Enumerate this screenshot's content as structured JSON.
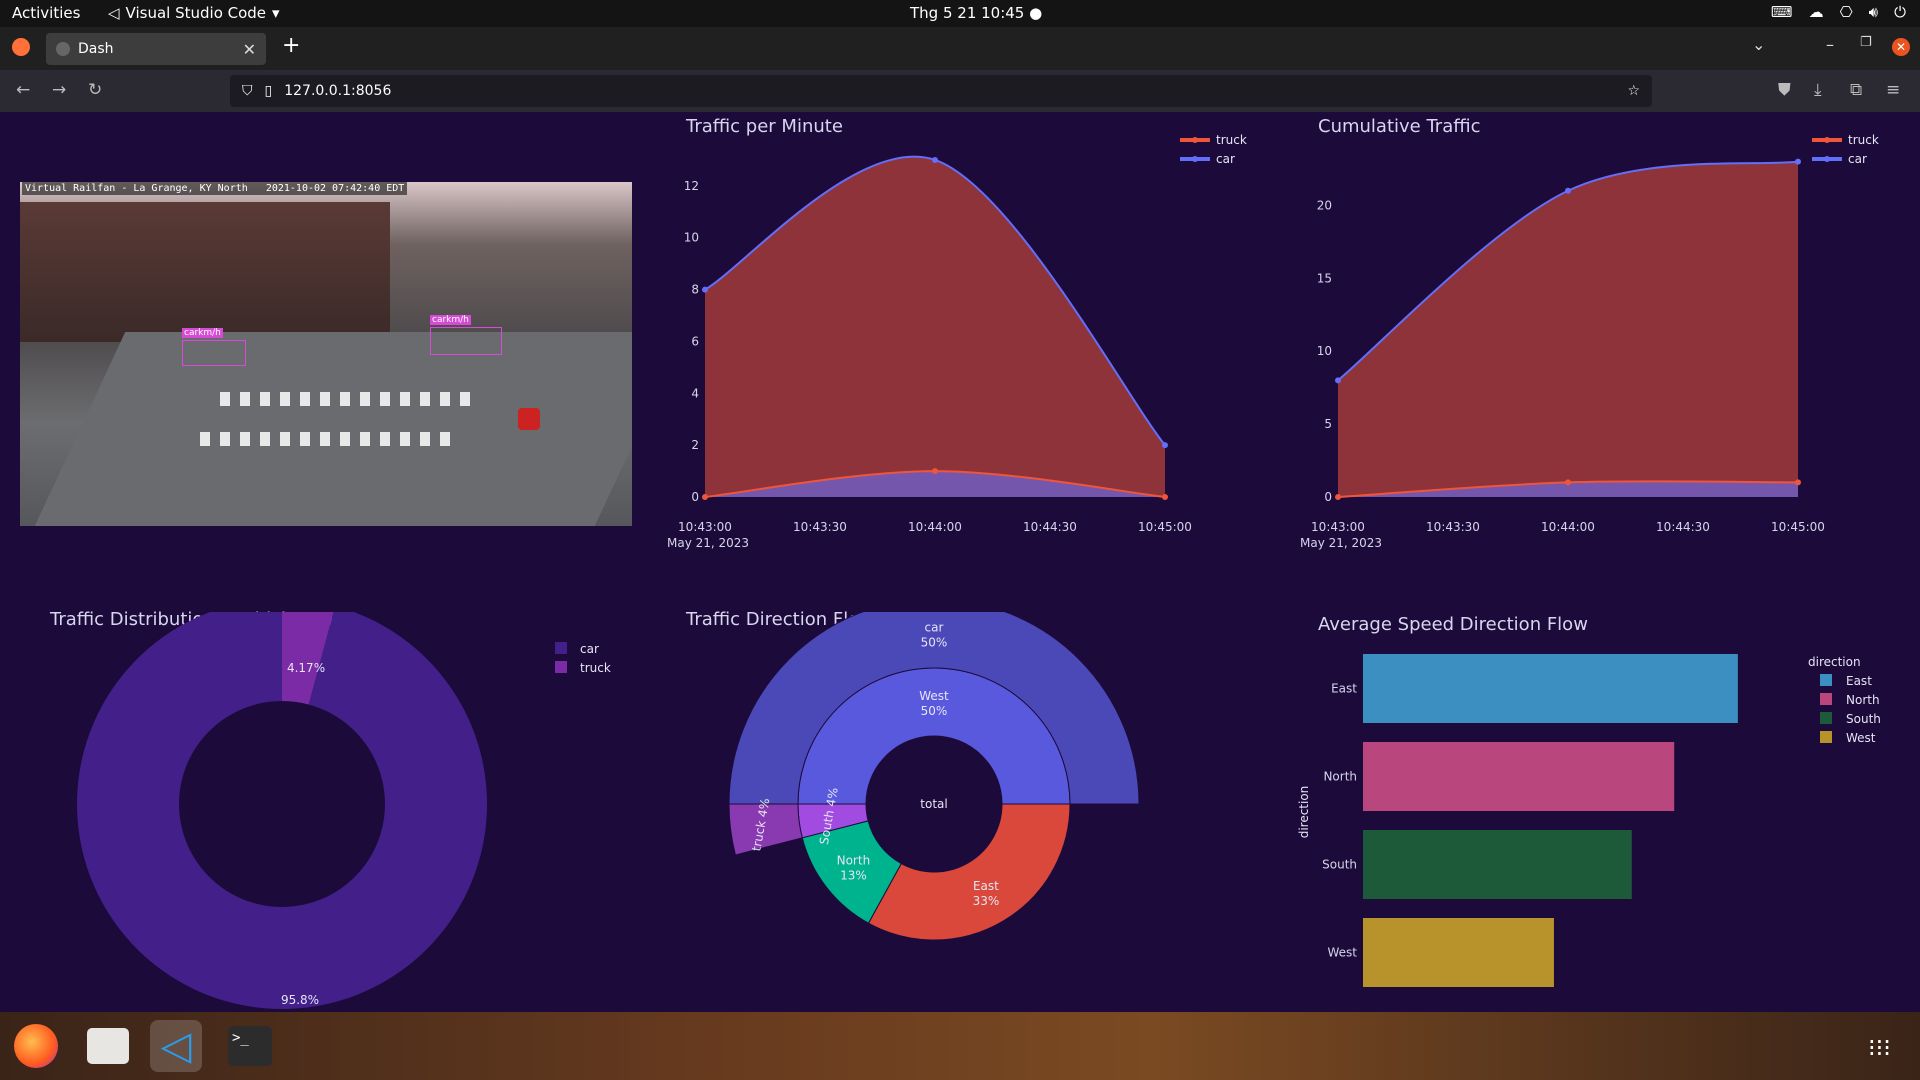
{
  "system": {
    "activities": "Activities",
    "app_name": "Visual Studio Code",
    "clock": "Thg 5 21  10:45"
  },
  "browser": {
    "tab_title": "Dash",
    "url": "127.0.0.1:8056"
  },
  "video": {
    "overlay": "Virtual Railfan - La Grange, KY North   2021-10-02 07:42:40 EDT",
    "det1": "carkm/h",
    "det2": "carkm/h"
  },
  "charts": {
    "traffic_title": "Traffic per Minute",
    "cumulative_title": "Cumulative Traffic",
    "distribution_title": "Traffic Distribution - Vehicle Type",
    "direction_title": "Traffic Direction Flow",
    "speed_title": "Average Speed Direction Flow"
  },
  "chart_data": [
    {
      "type": "area",
      "title": "Traffic per Minute",
      "x": [
        "10:43:00",
        "10:44:00",
        "10:45:00"
      ],
      "x_ticks": [
        "10:43:00",
        "10:43:30",
        "10:44:00",
        "10:44:30",
        "10:45:00"
      ],
      "x_date": "May 21, 2023",
      "series": [
        {
          "name": "truck",
          "values": [
            0,
            1,
            0
          ],
          "color": "#ef553b"
        },
        {
          "name": "car",
          "values": [
            8,
            13,
            2
          ],
          "color": "#636efa"
        }
      ],
      "y_ticks": [
        0,
        2,
        4,
        6,
        8,
        10,
        12
      ],
      "ylim": [
        0,
        13.5
      ],
      "legend": "top-right"
    },
    {
      "type": "area",
      "title": "Cumulative Traffic",
      "x": [
        "10:43:00",
        "10:44:00",
        "10:45:00"
      ],
      "x_ticks": [
        "10:43:00",
        "10:43:30",
        "10:44:00",
        "10:44:30",
        "10:45:00"
      ],
      "x_date": "May 21, 2023",
      "series": [
        {
          "name": "truck",
          "values": [
            0,
            1,
            1
          ],
          "color": "#ef553b"
        },
        {
          "name": "car",
          "values": [
            8,
            21,
            23
          ],
          "color": "#636efa"
        }
      ],
      "y_ticks": [
        0,
        5,
        10,
        15,
        20
      ],
      "ylim": [
        0,
        24
      ],
      "legend": "top-right"
    },
    {
      "type": "pie",
      "title": "Traffic Distribution - Vehicle Type",
      "labels": [
        "car",
        "truck"
      ],
      "values": [
        95.8,
        4.17
      ],
      "value_labels": [
        "95.8%",
        "4.17%"
      ],
      "colors": [
        "#431f8a",
        "#7b2ba6"
      ],
      "legend": "top-right"
    },
    {
      "type": "sunburst",
      "title": "Traffic Direction Flow",
      "center": "total",
      "inner": [
        {
          "label": "West",
          "pct": "50%",
          "value": 50,
          "color": "#5959de"
        },
        {
          "label": "East",
          "pct": "33%",
          "value": 33,
          "color": "#d9483b"
        },
        {
          "label": "North",
          "pct": "13%",
          "value": 13,
          "color": "#00b38f"
        },
        {
          "label": "South",
          "pct": "4%",
          "value": 4,
          "color": "#a24be0"
        }
      ],
      "outer": [
        {
          "label": "car",
          "pct": "50%",
          "value": 50,
          "color": "#4b48b8"
        },
        {
          "label": "truck",
          "pct": "4%",
          "value": 4,
          "color": "#8a3ab0"
        }
      ]
    },
    {
      "type": "bar",
      "orientation": "horizontal",
      "title": "Average Speed Direction Flow",
      "categories": [
        "East",
        "North",
        "South",
        "West"
      ],
      "values": [
        53,
        44,
        38,
        27
      ],
      "colors": [
        "#3b8fc1",
        "#b9477d",
        "#1d5a3a",
        "#b8922a"
      ],
      "ylabel": "direction",
      "legend_title": "direction",
      "x_ticks": [
        0,
        10,
        20,
        30,
        40,
        50
      ],
      "xlim": [
        0,
        55
      ]
    }
  ]
}
